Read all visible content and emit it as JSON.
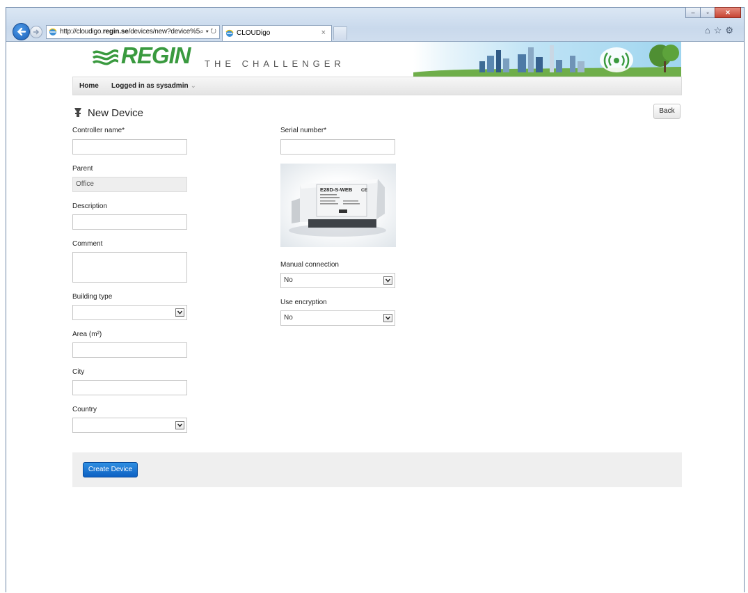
{
  "browser": {
    "url_prefix": "http://cloudigo.",
    "url_domain": "regin.se",
    "url_rest": "/devices/new?device%5",
    "address_tools": "⌕ ▾ ↻",
    "tab_title": "CLOUDigo",
    "tab_close": "×"
  },
  "header": {
    "logo": "REGIN",
    "tagline": "THE CHALLENGER"
  },
  "nav": {
    "home": "Home",
    "logged_in": "Logged in as sysadmin"
  },
  "page": {
    "title": "New Device",
    "back": "Back"
  },
  "form": {
    "controller_name": {
      "label": "Controller name*",
      "value": ""
    },
    "parent": {
      "label": "Parent",
      "value": "Office"
    },
    "description": {
      "label": "Description",
      "value": ""
    },
    "comment": {
      "label": "Comment",
      "value": ""
    },
    "building_type": {
      "label": "Building type",
      "value": ""
    },
    "area": {
      "label": "Area (m²)",
      "value": ""
    },
    "city": {
      "label": "City",
      "value": ""
    },
    "country": {
      "label": "Country",
      "value": ""
    },
    "serial_number": {
      "label": "Serial number*",
      "value": ""
    },
    "manual_connection": {
      "label": "Manual connection",
      "value": "No"
    },
    "use_encryption": {
      "label": "Use encryption",
      "value": "No"
    }
  },
  "device_image": {
    "model": "E28D-S-WEB",
    "ce": "CE"
  },
  "footer": {
    "create": "Create Device"
  },
  "colors": {
    "brand_green": "#3a9a3f",
    "primary_button": "#1a74d2"
  }
}
